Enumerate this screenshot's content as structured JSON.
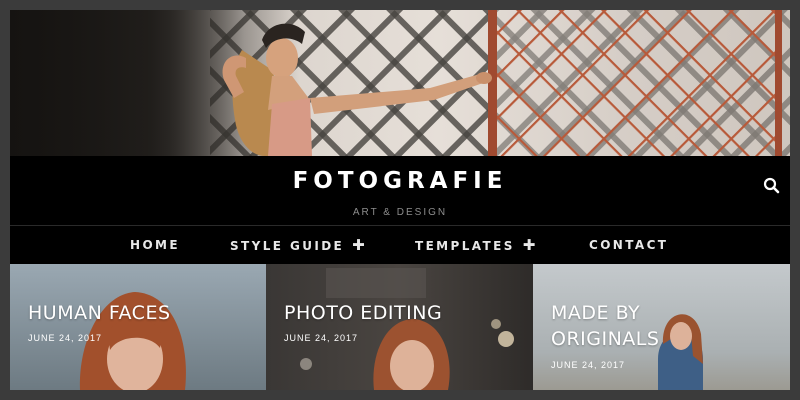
{
  "site": {
    "title": "FOTOGRAFIE",
    "tagline": "ART & DESIGN"
  },
  "nav": {
    "items": [
      {
        "label": "HOME",
        "has_submenu": false
      },
      {
        "label": "STYLE GUIDE",
        "has_submenu": true
      },
      {
        "label": "TEMPLATES",
        "has_submenu": true
      },
      {
        "label": "CONTACT",
        "has_submenu": false
      }
    ],
    "submenu_icon": "plus-icon"
  },
  "header_icons": [
    "search-icon"
  ],
  "cards": [
    {
      "title": "HUMAN FACES",
      "date": "JUNE 24, 2017"
    },
    {
      "title": "PHOTO EDITING",
      "date": "JUNE 24, 2017"
    },
    {
      "title_line1": "MADE BY",
      "title_line2": "ORIGINALS",
      "date": "JUNE 24, 2017"
    }
  ],
  "colors": {
    "background": "#000000",
    "frame": "#3b3b3b",
    "text": "#ffffff",
    "tagline": "#8d8d8d",
    "gate": "#b85a3a"
  }
}
